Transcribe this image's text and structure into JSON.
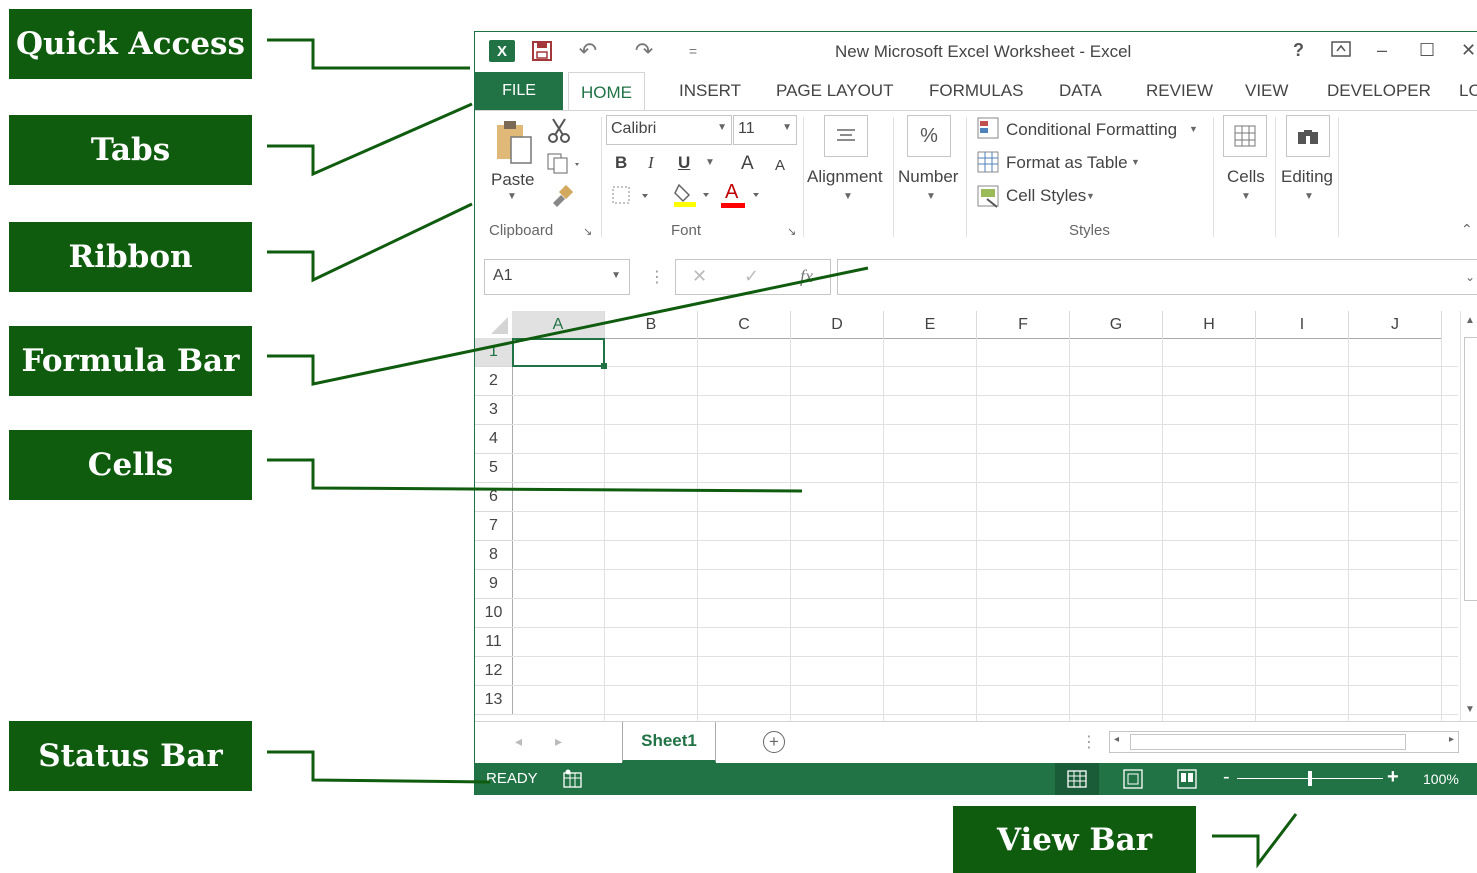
{
  "callouts": {
    "quick_access": "Quick Access",
    "tabs": "Tabs",
    "ribbon": "Ribbon",
    "formula_bar": "Formula Bar",
    "cells": "Cells",
    "status_bar": "Status Bar",
    "view_bar": "View Bar"
  },
  "colors": {
    "label_bg": "#0f5c0f",
    "excel_green": "#217346",
    "line": "#0f5c0f"
  },
  "window": {
    "title": "New Microsoft Excel Worksheet - Excel",
    "help": "?",
    "minimize": "–",
    "maximize": "☐",
    "close": "✕"
  },
  "quick_access_toolbar": {
    "excel_logo": "X",
    "undo": "↶",
    "redo": "↷",
    "customize": "="
  },
  "tabs": {
    "file": "FILE",
    "items": [
      "HOME",
      "INSERT",
      "PAGE LAYOUT",
      "FORMULAS",
      "DATA",
      "REVIEW",
      "VIEW",
      "DEVELOPER",
      "LO"
    ]
  },
  "ribbon": {
    "clipboard": {
      "paste": "Paste",
      "group": "Clipboard"
    },
    "font": {
      "name": "Calibri",
      "size": "11",
      "bold": "B",
      "italic": "I",
      "underline": "U",
      "grow": "A",
      "shrink": "A",
      "font_color": "A",
      "group": "Font"
    },
    "alignment": {
      "label": "Alignment"
    },
    "number": {
      "label": "Number",
      "symbol": "%"
    },
    "styles": {
      "conditional": "Conditional Formatting",
      "format_table": "Format as Table",
      "cell_styles": "Cell Styles",
      "group": "Styles"
    },
    "cells": {
      "label": "Cells"
    },
    "editing": {
      "label": "Editing"
    }
  },
  "formula_bar": {
    "name_box": "A1",
    "cancel": "✕",
    "enter": "✓",
    "fx": "fx",
    "value": ""
  },
  "grid": {
    "columns": [
      "A",
      "B",
      "C",
      "D",
      "E",
      "F",
      "G",
      "H",
      "I",
      "J"
    ],
    "rows": [
      "1",
      "2",
      "3",
      "4",
      "5",
      "6",
      "7",
      "8",
      "9",
      "10",
      "11",
      "12",
      "13"
    ],
    "selected_cell": "A1"
  },
  "sheets": {
    "active": "Sheet1",
    "add": "+"
  },
  "status": {
    "ready": "READY",
    "zoom": "100%",
    "zoom_minus": "-",
    "zoom_plus": "+"
  }
}
